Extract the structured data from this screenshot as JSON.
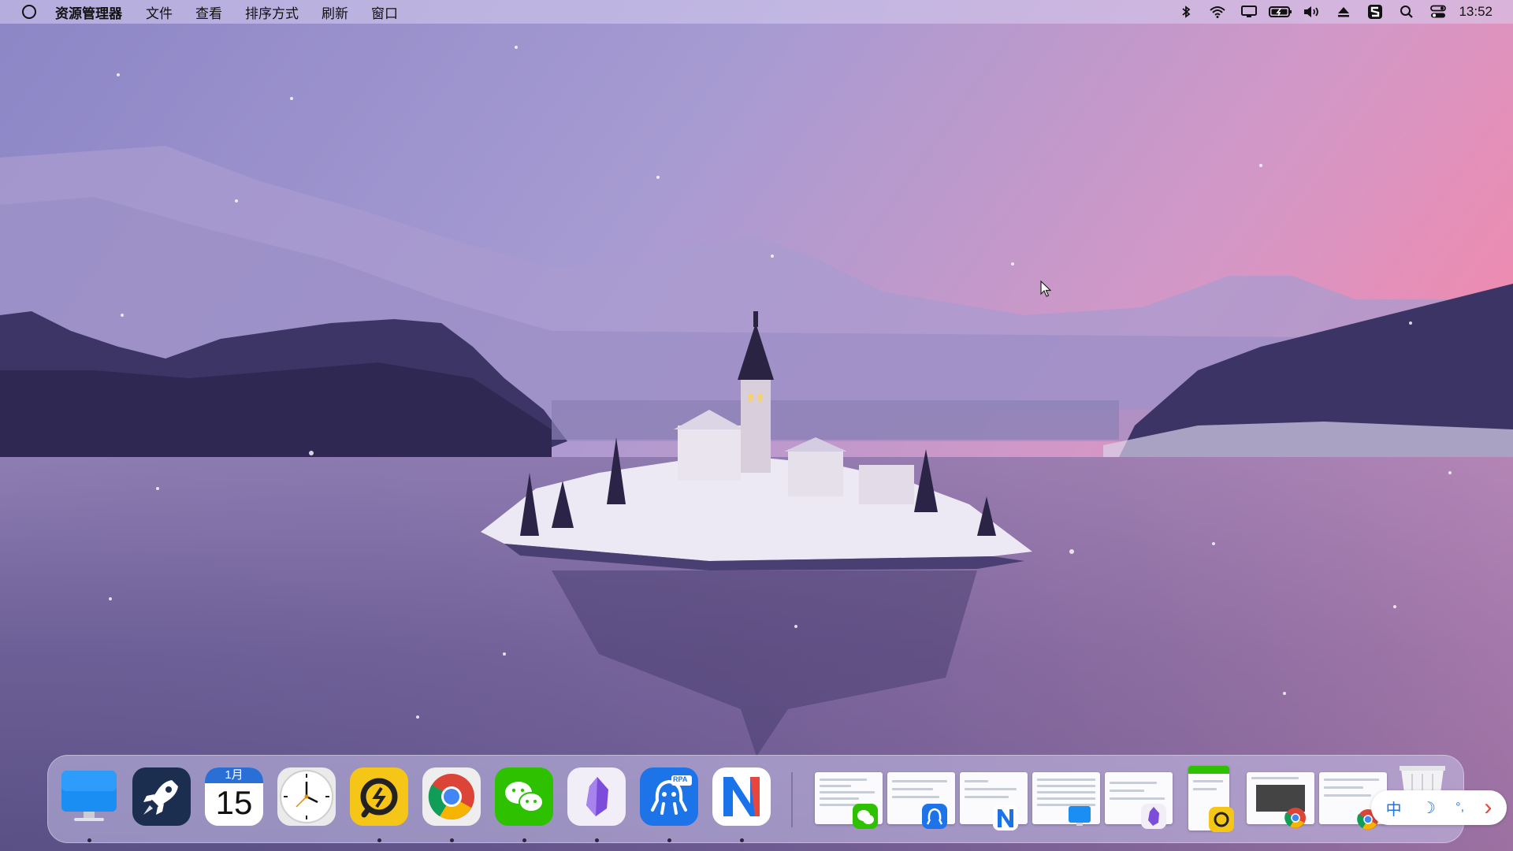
{
  "menubar": {
    "app_name": "资源管理器",
    "menus": [
      "文件",
      "查看",
      "排序方式",
      "刷新",
      "窗口"
    ],
    "clock": "13:52",
    "tray_icons": [
      "bluetooth-icon",
      "wifi-icon",
      "display-icon",
      "battery-icon",
      "volume-icon",
      "eject-icon",
      "sogou-input-icon",
      "search-icon",
      "control-center-icon"
    ]
  },
  "dock": {
    "apps": [
      {
        "name": "finder-monitor-icon",
        "running": true
      },
      {
        "name": "launchpad-rocket-icon",
        "running": false
      },
      {
        "name": "calendar-icon",
        "running": false,
        "month": "1月",
        "day": "15"
      },
      {
        "name": "clock-app-icon",
        "running": false
      },
      {
        "name": "remote-desktop-icon",
        "running": true
      },
      {
        "name": "chrome-icon",
        "running": true
      },
      {
        "name": "wechat-icon",
        "running": true
      },
      {
        "name": "obsidian-icon",
        "running": true
      },
      {
        "name": "rpa-robot-icon",
        "running": true,
        "badge": "RPA"
      },
      {
        "name": "notion-n-icon",
        "running": true
      }
    ],
    "window_thumbnails": [
      {
        "app": "wechat"
      },
      {
        "app": "rpa"
      },
      {
        "app": "notion"
      },
      {
        "app": "finder"
      },
      {
        "app": "obsidian"
      },
      {
        "app": "remote-desktop"
      },
      {
        "app": "chrome"
      },
      {
        "app": "chrome"
      }
    ]
  },
  "ime": {
    "mode": "中",
    "moon": "☽",
    "punct": "°,",
    "arrow": "›"
  },
  "colors": {
    "sky_top": "#8f86c7",
    "sky_pink": "#e98fb4",
    "water": "#6f6496",
    "accent_blue": "#1e73e6"
  }
}
